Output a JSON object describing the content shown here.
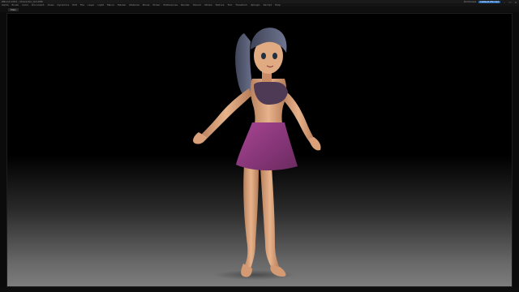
{
  "app": {
    "title": "ZBrush 2021 - Character_Girl.ZPR",
    "accent_color": "#2a6fb8"
  },
  "titlebar": {
    "right_label": "Quicksave",
    "accent_button": "Default ZScript",
    "win_min": "–",
    "win_max": "□",
    "win_close": "×"
  },
  "menu": {
    "items": [
      "Alpha",
      "Brush",
      "Color",
      "Document",
      "Draw",
      "Dynamics",
      "Edit",
      "File",
      "Layer",
      "Light",
      "Macro",
      "Marker",
      "Material",
      "Movie",
      "Picker",
      "Preferences",
      "Render",
      "Stencil",
      "Stroke",
      "Texture",
      "Tool",
      "Transform",
      "Zplugin",
      "Zscript",
      "Help"
    ]
  },
  "tabs": {
    "active": "Main"
  },
  "viewport": {
    "bg_top": "#000000",
    "bg_bottom": "#7d7d7d",
    "figure": {
      "skin_color": "#dba57e",
      "hair_color": "#535a72",
      "top_color": "#4f3a55",
      "skirt_color": "#8f3a80"
    }
  }
}
